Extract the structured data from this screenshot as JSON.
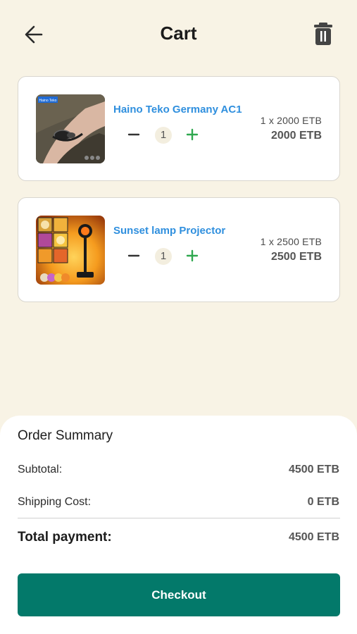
{
  "header": {
    "title": "Cart",
    "back_icon": "arrow-left-icon",
    "trash_icon": "trash-icon"
  },
  "cart": {
    "items": [
      {
        "name": "Haino Teko Germany AC1",
        "quantity": "1",
        "unit_price_text": "1 x 2000 ETB",
        "line_total": "2000 ETB",
        "image_badge": "Haino Teko"
      },
      {
        "name": "Sunset lamp Projector",
        "quantity": "1",
        "unit_price_text": "1 x 2500 ETB",
        "line_total": "2500 ETB"
      }
    ]
  },
  "summary": {
    "title": "Order Summary",
    "subtotal_label": "Subtotal:",
    "subtotal_value": "4500 ETB",
    "shipping_label": "Shipping Cost:",
    "shipping_value": "0 ETB",
    "total_label": "Total payment:",
    "total_value": "4500 ETB"
  },
  "checkout": {
    "label": "Checkout"
  },
  "colors": {
    "background": "#f8f3e5",
    "product_name": "#2f8fde",
    "plus": "#2fa84f",
    "checkout": "#03796a"
  }
}
